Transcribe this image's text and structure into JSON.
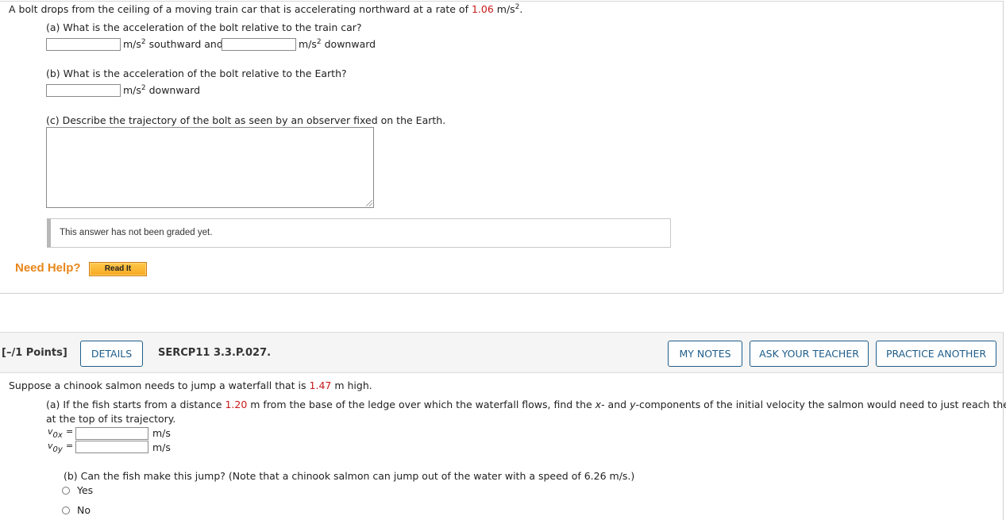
{
  "question1": {
    "prompt_prefix": "A bolt drops from the ceiling of a moving train car that is accelerating northward at a rate of ",
    "prompt_value": "1.06",
    "prompt_unit": " m/s",
    "prompt_exp": "2",
    "prompt_end": ".",
    "part_a": {
      "question": "(a) What is the acceleration of the bolt relative to the train car?",
      "answer1_value": "",
      "unit1": "m/s",
      "unit1_exp": "2",
      "unit1_suffix": " southward and",
      "answer2_value": "",
      "unit2": "m/s",
      "unit2_exp": "2",
      "unit2_suffix": " downward"
    },
    "part_b": {
      "question": "(b) What is the acceleration of the bolt relative to the Earth?",
      "answer_value": "",
      "unit": "m/s",
      "unit_exp": "2",
      "unit_suffix": " downward"
    },
    "part_c": {
      "question": "(c) Describe the trajectory of the bolt as seen by an observer fixed on the Earth.",
      "answer_value": ""
    },
    "graded_status": "This answer has not been graded yet.",
    "need_help_label": "Need Help?",
    "read_it_label": "Read It"
  },
  "question2": {
    "points": "[–/1 Points]",
    "details_label": "DETAILS",
    "code": "SERCP11 3.3.P.027.",
    "my_notes_label": "MY NOTES",
    "ask_teacher_label": "ASK YOUR TEACHER",
    "practice_another_label": "PRACTICE ANOTHER",
    "prompt_prefix": "Suppose a chinook salmon needs to jump a waterfall that is ",
    "prompt_value": "1.47",
    "prompt_suffix": " m high.",
    "part_a": {
      "line1_prefix": "(a) If the fish starts from a distance ",
      "line1_value": "1.20",
      "line1_mid": " m from the base of the ledge over which the waterfall flows, find the ",
      "x_var": "x",
      "and_text": "- and ",
      "y_var": "y",
      "line1_end": "-components of the initial velocity the salmon would need to just reach the ledge",
      "line2": "at the top of its trajectory.",
      "v0x_label": "v",
      "v0x_sub": "0x",
      "v0y_label": "v",
      "v0y_sub": "0y",
      "equals": "=",
      "v0x_value": "",
      "v0y_value": "",
      "unit": "m/s"
    },
    "part_b": {
      "question": "(b) Can the fish make this jump? (Note that a chinook salmon can jump out of the water with a speed of 6.26 m/s.)",
      "options": [
        "Yes",
        "No"
      ],
      "selected": null
    }
  },
  "colors": {
    "value_red": "#c81a1a",
    "need_help_orange": "#e8861a",
    "button_blue": "#1f5d8a"
  }
}
